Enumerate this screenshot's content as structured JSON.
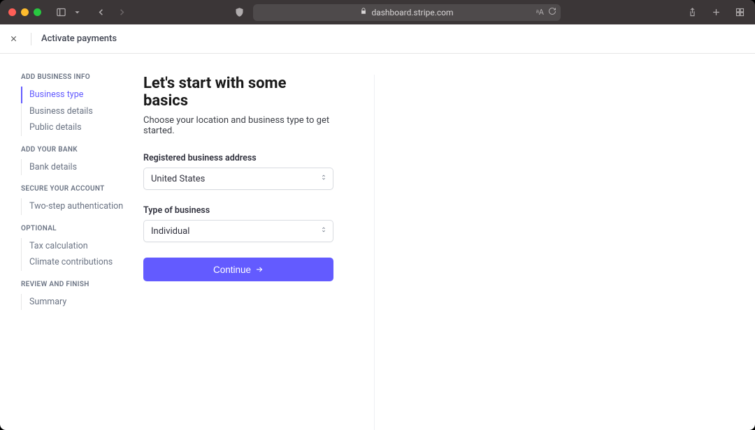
{
  "browser": {
    "url": "dashboard.stripe.com"
  },
  "header": {
    "title": "Activate payments"
  },
  "sidebar": {
    "sections": [
      {
        "title": "ADD BUSINESS INFO",
        "items": [
          {
            "label": "Business type",
            "active": true
          },
          {
            "label": "Business details",
            "active": false
          },
          {
            "label": "Public details",
            "active": false
          }
        ]
      },
      {
        "title": "ADD YOUR BANK",
        "items": [
          {
            "label": "Bank details",
            "active": false
          }
        ]
      },
      {
        "title": "SECURE YOUR ACCOUNT",
        "items": [
          {
            "label": "Two-step authentication",
            "active": false
          }
        ]
      },
      {
        "title": "OPTIONAL",
        "items": [
          {
            "label": "Tax calculation",
            "active": false
          },
          {
            "label": "Climate contributions",
            "active": false
          }
        ]
      },
      {
        "title": "REVIEW AND FINISH",
        "items": [
          {
            "label": "Summary",
            "active": false
          }
        ]
      }
    ]
  },
  "main": {
    "heading": "Let's start with some basics",
    "subheading": "Choose your location and business type to get started.",
    "fields": {
      "address_label": "Registered business address",
      "address_value": "United States",
      "business_type_label": "Type of business",
      "business_type_value": "Individual"
    },
    "continue_label": "Continue"
  }
}
